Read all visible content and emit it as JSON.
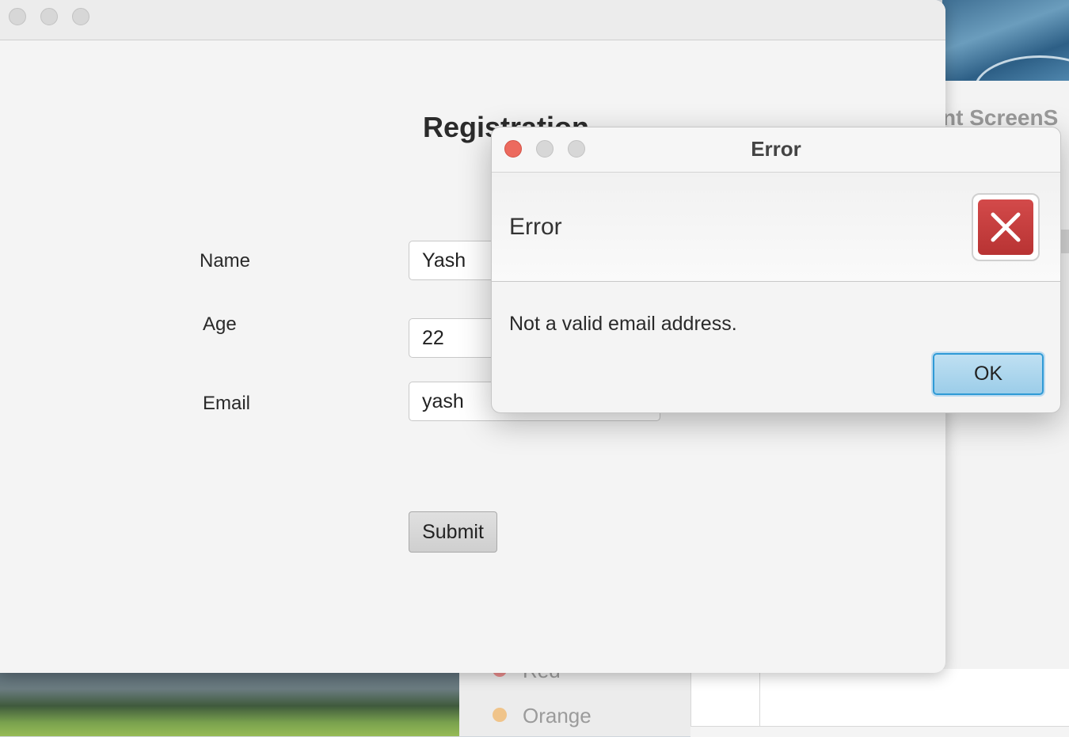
{
  "background": {
    "right_partial_text": "nt  ScreenS",
    "legend": [
      {
        "label": "Red",
        "color": "#e98c8c"
      },
      {
        "label": "Orange",
        "color": "#f0c48a"
      }
    ]
  },
  "main_window": {
    "heading": "Registration",
    "fields": [
      {
        "label": "Name",
        "value": "Yash"
      },
      {
        "label": "Age",
        "value": "22"
      },
      {
        "label": "Email",
        "value": "yash"
      }
    ],
    "submit_label": "Submit"
  },
  "dialog": {
    "title": "Error",
    "header_text": "Error",
    "message": "Not a valid email address.",
    "ok_label": "OK",
    "icon": "error-x-icon",
    "close_color": "#ec6a5e"
  }
}
